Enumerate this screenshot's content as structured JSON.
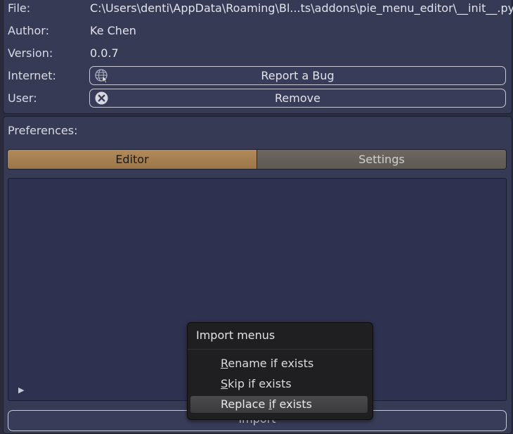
{
  "info": {
    "file_label": "File:",
    "file_value": "C:\\Users\\denti\\AppData\\Roaming\\Bl...ts\\addons\\pie_menu_editor\\__init__.py",
    "author_label": "Author:",
    "author_value": "Ke Chen",
    "version_label": "Version:",
    "version_value": "0.0.7",
    "internet_label": "Internet:",
    "report_bug_label": "Report a Bug",
    "user_label": "User:",
    "remove_label": "Remove"
  },
  "preferences": {
    "label": "Preferences:",
    "tabs": [
      {
        "label": "Editor",
        "active": true
      },
      {
        "label": "Settings",
        "active": false
      }
    ],
    "import_label": "Import"
  },
  "import_menu": {
    "title": "Import menus",
    "items": [
      {
        "pre": "",
        "u": "R",
        "post": "ename if exists",
        "highlighted": false
      },
      {
        "pre": "",
        "u": "S",
        "post": "kip if exists",
        "highlighted": false
      },
      {
        "pre": "Replace ",
        "u": "i",
        "post": "f exists",
        "highlighted": true
      }
    ]
  },
  "colors": {
    "active_tab": "#b08a5a",
    "panel": "#363a55",
    "content": "#2f3150",
    "menu_bg": "#1f1f21"
  },
  "icons": {
    "internet": "globe-cursor-icon",
    "remove": "x-circle-icon",
    "expand": "disclosure-triangle-icon"
  }
}
